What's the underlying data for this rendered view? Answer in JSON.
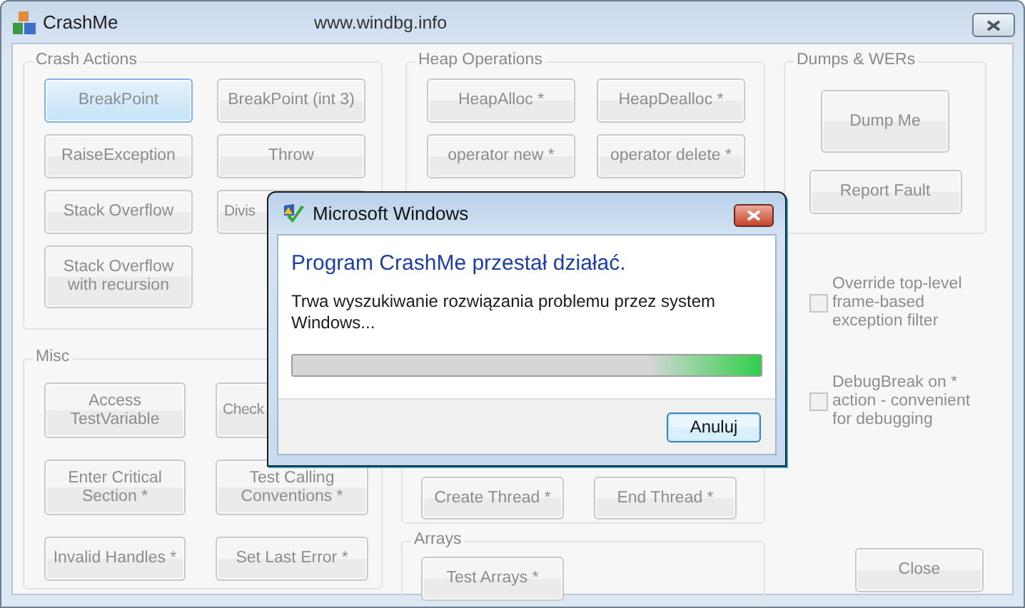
{
  "window": {
    "title": "CrashMe",
    "subtitle": "www.windbg.info",
    "disabled": true
  },
  "crash_actions": {
    "title": "Crash Actions",
    "buttons": [
      {
        "label": "BreakPoint",
        "focused": true
      },
      {
        "label": "BreakPoint (int 3)",
        "focused": false
      },
      {
        "label": "RaiseException",
        "focused": false
      },
      {
        "label": "Throw",
        "focused": false
      },
      {
        "label": "Stack Overflow",
        "focused": false
      },
      {
        "label": "Divis",
        "focused": false,
        "cut": true
      },
      {
        "label": "Stack Overflow with recursion",
        "focused": false
      }
    ]
  },
  "misc": {
    "title": "Misc",
    "buttons": [
      {
        "label": "Access TestVariable",
        "cut": false
      },
      {
        "label": "Check",
        "cut": true
      },
      {
        "label": "Enter Critical Section *",
        "cut": false
      },
      {
        "label": "Test Calling Conventions *",
        "cut": false
      },
      {
        "label": "Invalid Handles *",
        "cut": false
      },
      {
        "label": "Set Last Error *",
        "cut": false
      }
    ]
  },
  "heap_operations": {
    "title": "Heap Operations",
    "buttons": [
      "HeapAlloc *",
      "HeapDealloc *",
      "operator new *",
      "operator delete *"
    ]
  },
  "threads": {
    "buttons": [
      "Create Thread *",
      "End Thread *"
    ]
  },
  "arrays": {
    "title": "Arrays",
    "buttons": [
      "Test Arrays *"
    ]
  },
  "dumps": {
    "title": "Dumps & WERs",
    "buttons": [
      "Dump Me",
      "Report Fault"
    ]
  },
  "options": [
    {
      "label": "Override top-level frame-based exception filter",
      "checked": false
    },
    {
      "label": "DebugBreak on * action - convenient for debugging",
      "checked": false
    }
  ],
  "close_button": "Close",
  "dialog": {
    "title": "Microsoft Windows",
    "heading": "Program CrashMe przestał działać.",
    "message": "Trwa wyszukiwanie rozwiązania problemu przez system Windows...",
    "button": "Anuluj",
    "progress": {
      "level": 1
    }
  }
}
